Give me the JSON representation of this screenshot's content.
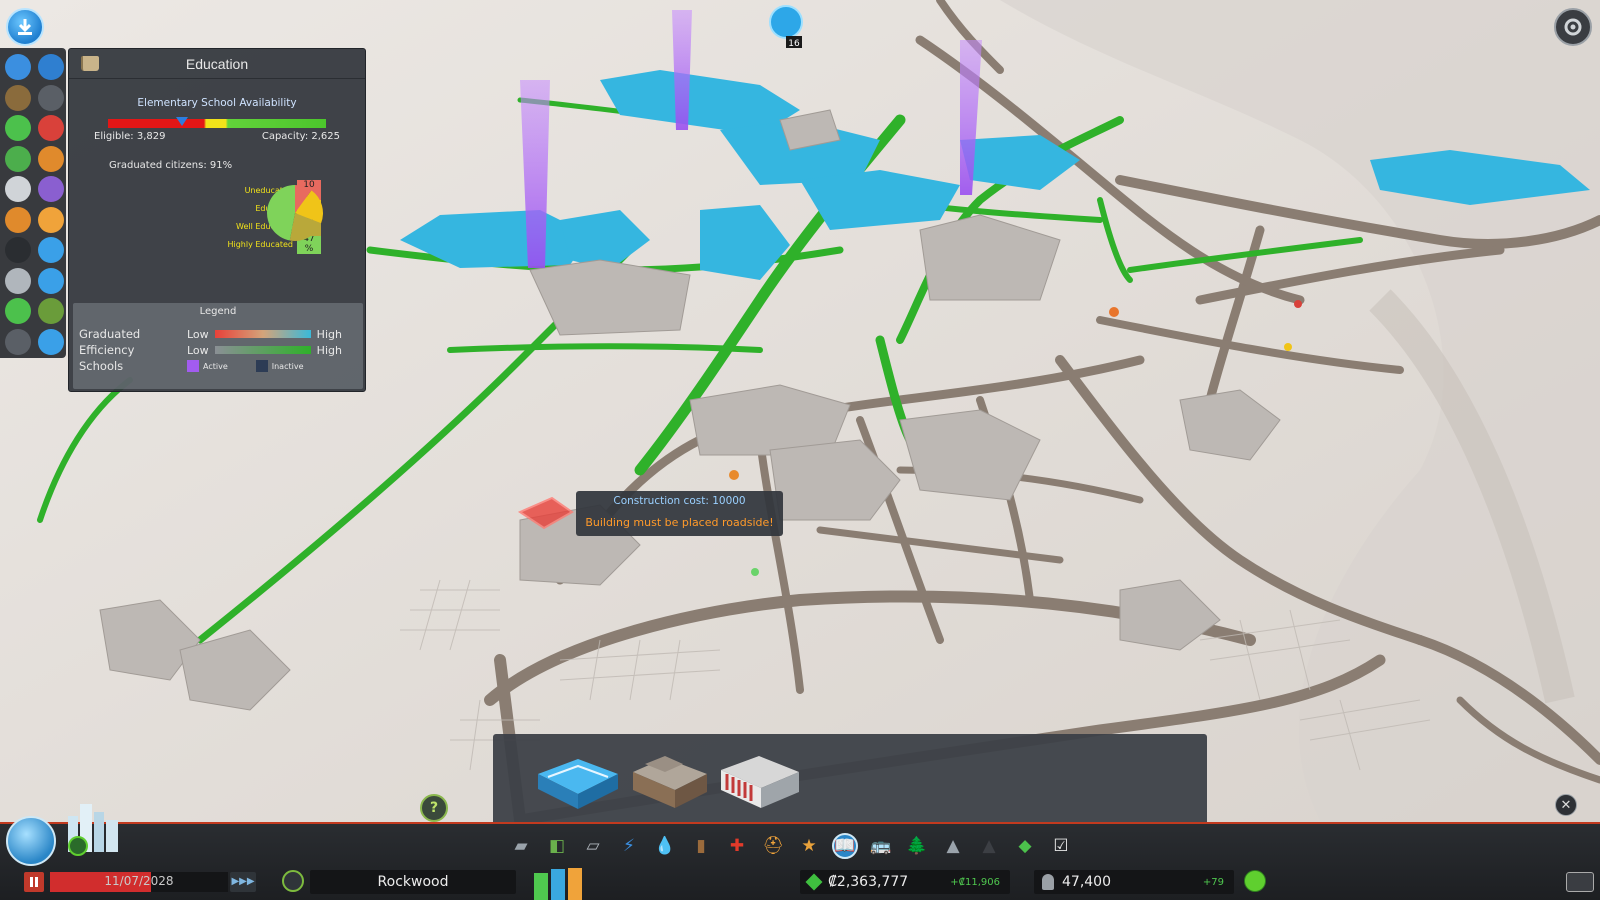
{
  "education_panel": {
    "title": "Education",
    "availability_title": "Elementary School Availability",
    "availability_marker_pct": 34,
    "eligible": "Eligible: 3,829",
    "capacity": "Capacity: 2,625",
    "graduated": "Graduated citizens: 91%",
    "breakdown": [
      {
        "label": "Uneducated",
        "value": "10 %",
        "pct": 10,
        "color": "#e86a5f"
      },
      {
        "label": "Educated",
        "value": "21 %",
        "pct": 21,
        "color": "#f0c418"
      },
      {
        "label": "Well Educated",
        "value": "22 %",
        "pct": 22,
        "color": "#b9a83a"
      },
      {
        "label": "Highly Educated",
        "value": "47 %",
        "pct": 47,
        "color": "#7fd35a"
      }
    ],
    "legend": {
      "title": "Legend",
      "graduated_label": "Graduated",
      "efficiency_label": "Efficiency",
      "schools_label": "Schools",
      "low": "Low",
      "high": "High",
      "active": "Active",
      "inactive": "Inactive",
      "active_color": "#a25cf0",
      "inactive_color": "#2d3c55"
    }
  },
  "tooltip": {
    "cost": "Construction cost: 10000",
    "warning": "Building must be placed roadside!"
  },
  "infoview_icons": [
    "electricity-icon",
    "water-icon",
    "garbage-icon",
    "pollution-icon",
    "happiness-icon",
    "health-icon",
    "landvalue-icon",
    "noise-icon",
    "traffic-icon",
    "crime-icon",
    "fire-icon",
    "police-icon",
    "education-icon",
    "public-transport-icon",
    "population-icon",
    "wind-icon",
    "economy-icon",
    "resources-icon",
    "district-icon",
    "time-icon"
  ],
  "assets": [
    "elementary-school",
    "high-school",
    "university"
  ],
  "toolbar_icons": [
    {
      "name": "roads-icon",
      "glyph": "▰",
      "color": "#9aa3ab"
    },
    {
      "name": "zoning-icon",
      "glyph": "◧",
      "color": "#6ab04c"
    },
    {
      "name": "districts-icon",
      "glyph": "▱",
      "color": "#b0b6bc"
    },
    {
      "name": "electricity-icon",
      "glyph": "⚡",
      "color": "#3b8fe0"
    },
    {
      "name": "water-icon",
      "glyph": "💧",
      "color": "#3aa0e8"
    },
    {
      "name": "garbage-icon",
      "glyph": "▮",
      "color": "#9b6b3c"
    },
    {
      "name": "healthcare-icon",
      "glyph": "✚",
      "color": "#e23a2a"
    },
    {
      "name": "fire-department-icon",
      "glyph": "⛑",
      "color": "#f0a33a"
    },
    {
      "name": "police-icon",
      "glyph": "★",
      "color": "#e9a23b"
    },
    {
      "name": "education-icon",
      "glyph": "📖",
      "color": "#ffffff"
    },
    {
      "name": "public-transport-icon",
      "glyph": "🚌",
      "color": "#f2d13a"
    },
    {
      "name": "beautification-icon",
      "glyph": "🌲",
      "color": "#4cae4c"
    },
    {
      "name": "monuments-icon",
      "glyph": "▲",
      "color": "#9aa3ab"
    },
    {
      "name": "wonders-icon",
      "glyph": "▲",
      "color": "#3c3f44"
    },
    {
      "name": "money-icon",
      "glyph": "◆",
      "color": "#4cc14c"
    },
    {
      "name": "policies-icon",
      "glyph": "☑",
      "color": "#e6e6e6"
    }
  ],
  "status_bar": {
    "date": "11/07/2028",
    "date_progress_pct": 57,
    "speed": "▶▶▶",
    "city_name": "Rockwood",
    "rci": [
      {
        "name": "residential",
        "level": 0.8,
        "color": "#4fc94f"
      },
      {
        "name": "commercial",
        "level": 0.9,
        "color": "#3aa8e0"
      },
      {
        "name": "industrial",
        "level": 0.95,
        "color": "#f0a33a"
      }
    ],
    "money": "₡2,363,777",
    "income": "+₡11,906",
    "population": "47,400",
    "pop_delta": "+79"
  },
  "help_glyph": "?",
  "close_glyph": "✕"
}
